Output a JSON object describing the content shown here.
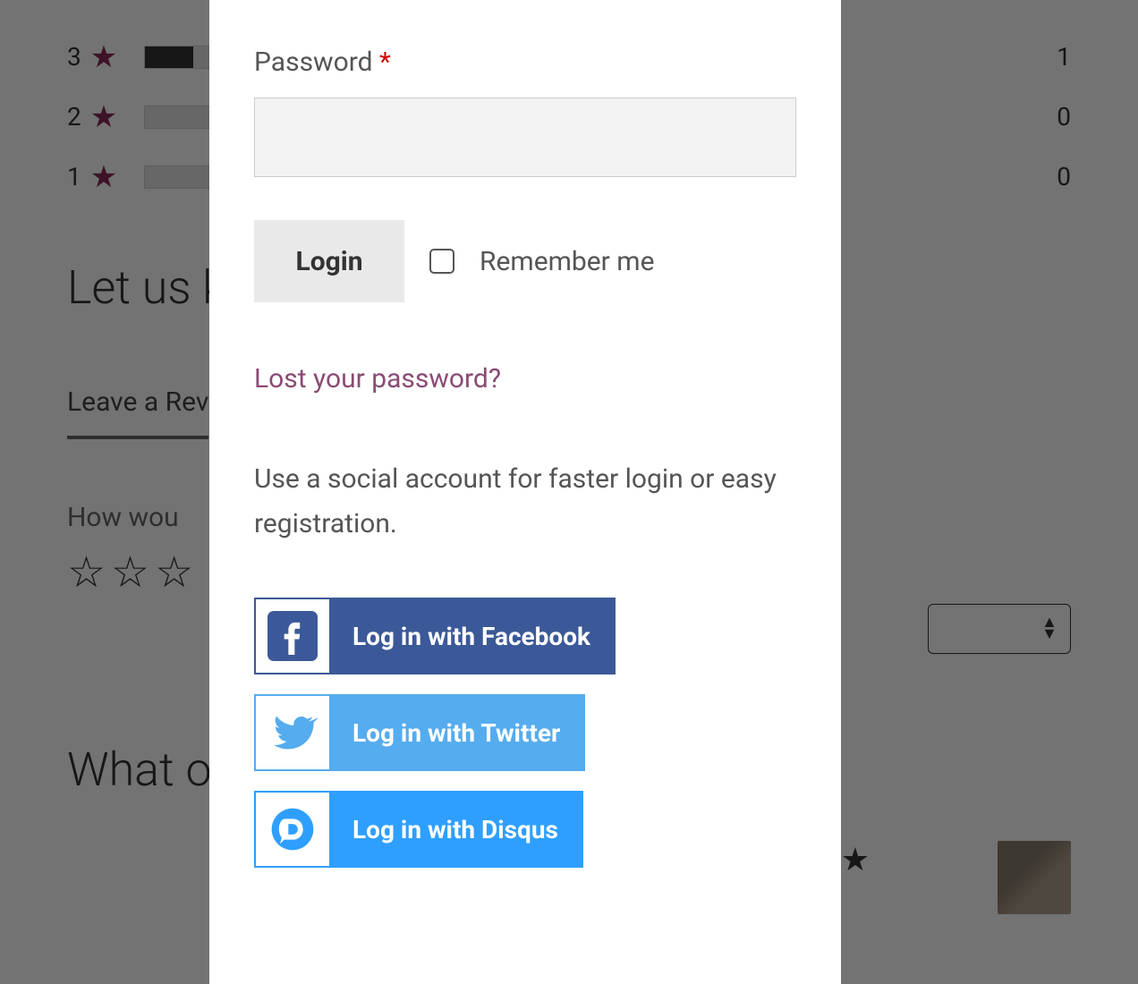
{
  "background": {
    "ratings": [
      {
        "stars": 3,
        "count": 1,
        "fill_pct": 50
      },
      {
        "stars": 2,
        "count": 0,
        "fill_pct": 0
      },
      {
        "stars": 1,
        "count": 0,
        "fill_pct": 0
      }
    ],
    "headline": "Let us k",
    "tab": "Leave a Rev",
    "how_would": "How wou",
    "what_others": "What ot"
  },
  "modal": {
    "password_label": "Password",
    "required_mark": "*",
    "login_label": "Login",
    "remember_label": "Remember me",
    "lost_password": "Lost your password?",
    "social_text": "Use a social account for faster login or easy registration.",
    "facebook_label": "Log in with Facebook",
    "twitter_label": "Log in with Twitter",
    "disqus_label": "Log in with Disqus"
  },
  "colors": {
    "facebook": "#3b5998",
    "twitter": "#55acee",
    "disqus": "#2e9fff",
    "link": "#8a4b73",
    "required": "#d40000"
  }
}
